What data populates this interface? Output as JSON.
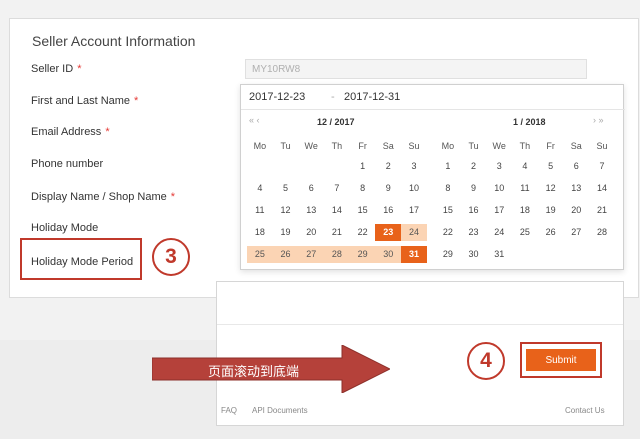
{
  "form": {
    "title": "Seller Account Information",
    "seller_id_label": "Seller ID",
    "seller_id_value": "MY10RW8",
    "name_label": "First and Last Name",
    "email_label": "Email Address",
    "phone_label": "Phone number",
    "display_name_label": "Display Name / Shop Name",
    "holiday_mode_label": "Holiday Mode",
    "holiday_period_label": "Holiday Mode Period",
    "required_marker": "*"
  },
  "datepicker": {
    "start_date": "2017-12-23",
    "separator": "-",
    "end_date": "2017-12-31",
    "prev_arrows": "« ‹",
    "next_arrows": "› »",
    "weekdays": [
      "Mo",
      "Tu",
      "We",
      "Th",
      "Fr",
      "Sa",
      "Su"
    ],
    "month1": {
      "header": "12 /  2017",
      "weeks": [
        [
          "",
          "",
          "",
          "",
          "1",
          "2",
          "3"
        ],
        [
          "4",
          "5",
          "6",
          "7",
          "8",
          "9",
          "10"
        ],
        [
          "11",
          "12",
          "13",
          "14",
          "15",
          "16",
          "17"
        ],
        [
          "18",
          "19",
          "20",
          "21",
          "22",
          "23",
          "24"
        ],
        [
          "25",
          "26",
          "27",
          "28",
          "29",
          "30",
          "31"
        ]
      ]
    },
    "month2": {
      "header": "1 /  2018",
      "weeks": [
        [
          "1",
          "2",
          "3",
          "4",
          "5",
          "6",
          "7"
        ],
        [
          "8",
          "9",
          "10",
          "11",
          "12",
          "13",
          "14"
        ],
        [
          "15",
          "16",
          "17",
          "18",
          "19",
          "20",
          "21"
        ],
        [
          "22",
          "23",
          "24",
          "25",
          "26",
          "27",
          "28"
        ],
        [
          "29",
          "30",
          "31",
          "",
          "",
          "",
          ""
        ]
      ]
    }
  },
  "annotations": {
    "step3": "3",
    "step4": "4",
    "arrow_text": "页面滚动到底端"
  },
  "footer": {
    "submit_label": "Submit",
    "faq_link": "FAQ",
    "api_link": "API Documents",
    "contact_link": "Contact Us"
  },
  "colors": {
    "accent": "#e8621a",
    "range_fill": "#fbd4b4",
    "annotation_red": "#c0392b",
    "arrow_fill": "#b5413a"
  }
}
